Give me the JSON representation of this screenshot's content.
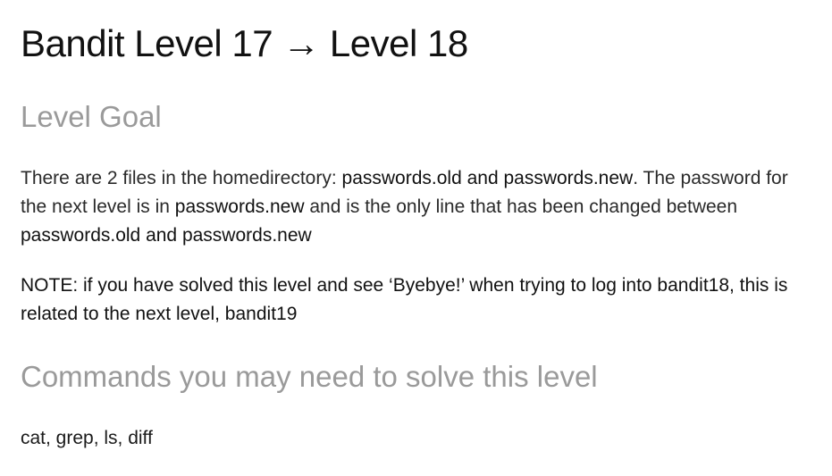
{
  "title": "Bandit Level 17 → Level 18",
  "goal": {
    "heading": "Level Goal",
    "part1": "There are 2 files in the homedirectory: ",
    "part2": "passwords.old and passwords.new",
    "part3": ". The password for the next level is in ",
    "part4": "passwords.new",
    "part5": " and is the only line that has been changed between ",
    "part6": "passwords.old and passwords.new"
  },
  "note": {
    "text": "NOTE: if you have solved this level and see ‘Byebye!’ when trying to log into bandit18, this is related to the next level, bandit19"
  },
  "commands": {
    "heading": "Commands you may need to solve this level",
    "list": "cat, grep, ls, diff"
  }
}
